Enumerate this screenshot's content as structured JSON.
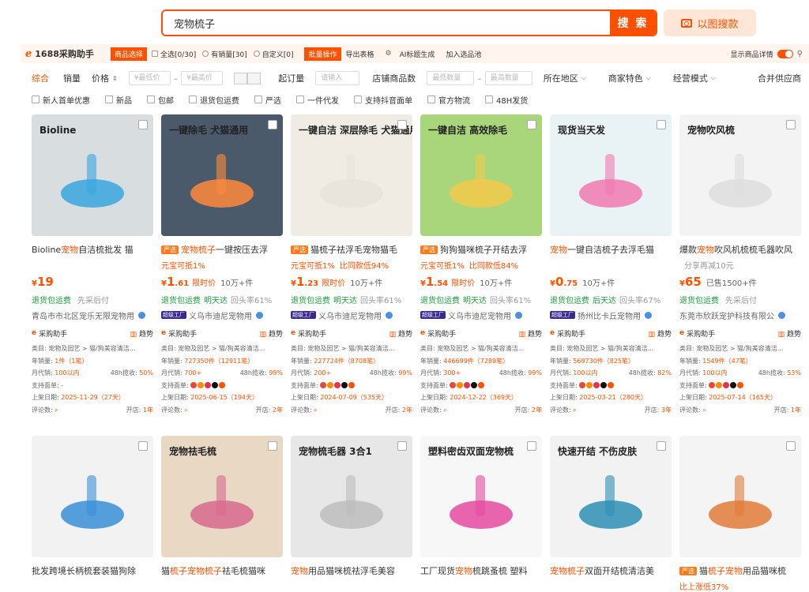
{
  "search": {
    "value": "宠物梳子",
    "button": "搜 索",
    "image_button": "以图搜款"
  },
  "helper": {
    "logo": "1688采购助手",
    "select_tag": "商品选择",
    "opts": [
      "全选[0/30]",
      "有销量[30]",
      "自定义[0]"
    ],
    "batch_tag": "批量操作",
    "links": [
      "导出表格",
      "AI标题生成",
      "加入选品池"
    ],
    "detail_toggle": "显示商品详情"
  },
  "filters": {
    "sort": [
      "综合",
      "销量",
      "价格"
    ],
    "price_min": "¥最低价",
    "price_max": "¥最高价",
    "moq_label": "起订量",
    "moq_ph": "请输入",
    "shops_label": "店铺商品数",
    "min_ph": "最低数量",
    "max_ph": "最高数量",
    "dropdowns": [
      "所在地区",
      "商家特色",
      "经营模式"
    ],
    "merge": "合并供应商",
    "checks": [
      "新人首单优惠",
      "新品",
      "包邮",
      "退货包运费",
      "严选",
      "一件代发",
      "支持抖音面单",
      "官方物流",
      "48H发货"
    ]
  },
  "products": [
    {
      "title_pre": "Bioline",
      "title_hl": "宠物",
      "title_post": "自洁梳批发 猫",
      "yx": "",
      "sub": "",
      "sub_gray": "",
      "price": "19",
      "price_dec": "",
      "price_note": "",
      "sold": "",
      "svc": [
        "退货包运费",
        ""
      ],
      "svc_gray": "先采后付",
      "shop": "青岛市市北区宠乐无限宠物用",
      "shop_badge": "",
      "helper": "采购助手",
      "trend": "趋势",
      "cat": "类目: 宠物及园艺 > 猫/狗美容清洁...",
      "year": "年销量:",
      "year_v": "1件（1笔）",
      "month": "月代销:",
      "month_v": "100以内",
      "h48": "48h揽收:",
      "h48_v": "50%",
      "support": "支持面单: -",
      "listed": "上架日期:",
      "listed_v": "2025-11-29（27天）",
      "review": "评论数:",
      "open": "开店:",
      "open_v": "1年"
    },
    {
      "title_pre": "",
      "title_hl": "宠物梳子",
      "title_post": "一键按压去浮",
      "yx": "严选",
      "sub": "元宝可抵1%",
      "sub_gray": "",
      "price": "1",
      "price_dec": ".61",
      "price_note": "限时价",
      "sold": "10万+件",
      "svc": [
        "退货包运费",
        "明天达"
      ],
      "svc_gray": "回头率61%",
      "shop": "义乌市迪尼宠物用",
      "shop_badge": "超级工厂",
      "helper": "采购助手",
      "trend": "趋势",
      "cat": "类目: 宠物及园艺 > 猫/狗美容清洁...",
      "year": "年销量:",
      "year_v": "727350件（12911笔）",
      "month": "月代销:",
      "month_v": "700+",
      "h48": "48h揽收:",
      "h48_v": "99%",
      "support": "支持面单:",
      "listed": "上架日期:",
      "listed_v": "2025-06-15（194天）",
      "review": "评论数:",
      "open": "开店:",
      "open_v": "2年"
    },
    {
      "title_pre": "",
      "title_hl": "",
      "title_post": "猫梳子祛浮毛宠物猫毛",
      "yx": "严选",
      "sub": "元宝可抵1%",
      "sub_gray": "比同款低94%",
      "price": "1",
      "price_dec": ".23",
      "price_note": "限时价",
      "sold": "10万+件",
      "svc": [
        "退货包运费",
        "明天达"
      ],
      "svc_gray": "回头率61%",
      "shop": "义乌市迪尼宠物用",
      "shop_badge": "超级工厂",
      "helper": "采购助手",
      "trend": "趋势",
      "cat": "类目: 宠物及园艺 > 猫/狗美容清洁...",
      "year": "年销量:",
      "year_v": "227724件（8708笔）",
      "month": "月代销:",
      "month_v": "200+",
      "h48": "48h揽收:",
      "h48_v": "99%",
      "support": "支持面单:",
      "listed": "上架日期:",
      "listed_v": "2024-07-09（535天）",
      "review": "评论数:",
      "open": "开店:",
      "open_v": "2年"
    },
    {
      "title_pre": "",
      "title_hl": "",
      "title_post": "狗狗猫咪梳子开结去浮",
      "yx": "严选",
      "sub": "元宝可抵1%",
      "sub_gray": "比同款低84%",
      "price": "1",
      "price_dec": ".54",
      "price_note": "限时价",
      "sold": "10万+件",
      "svc": [
        "退货包运费",
        "明天达"
      ],
      "svc_gray": "回头率61%",
      "shop": "义乌市迪尼宠物用",
      "shop_badge": "超级工厂",
      "helper": "采购助手",
      "trend": "趋势",
      "cat": "类目: 宠物及园艺 > 猫/狗美容清洁...",
      "year": "年销量:",
      "year_v": "446699件（7289笔）",
      "month": "月代销:",
      "month_v": "300+",
      "h48": "48h揽收:",
      "h48_v": "99%",
      "support": "支持面单:",
      "listed": "上架日期:",
      "listed_v": "2024-12-22（369天）",
      "review": "评论数:",
      "open": "开店:",
      "open_v": "2年"
    },
    {
      "title_pre": "",
      "title_hl": "宠物",
      "title_post": "一键自洁梳子去浮毛猫",
      "yx": "",
      "sub": "",
      "sub_gray": "",
      "price": "0",
      "price_dec": ".75",
      "price_note": "",
      "sold": "10万+件",
      "svc": [
        "退货包运费",
        "后天达"
      ],
      "svc_gray": "回头率67%",
      "shop": "扬州比卡丘宠物用",
      "shop_badge": "超级工厂",
      "helper": "采购助手",
      "trend": "趋势",
      "cat": "类目: 宠物及园艺 > 猫/狗美容清洁...",
      "year": "年销量:",
      "year_v": "569730件（825笔）",
      "month": "月代销:",
      "month_v": "100以内",
      "h48": "48h揽收:",
      "h48_v": "82%",
      "support": "支持面单:",
      "listed": "上架日期:",
      "listed_v": "2025-03-21（280天）",
      "review": "评论数:",
      "open": "开店:",
      "open_v": "3年"
    },
    {
      "title_pre": "爆款",
      "title_hl": "宠物",
      "title_post": "吹风机梳梳毛器吹风",
      "yx": "",
      "sub": "",
      "sub_gray": "分享再减10元",
      "price": "65",
      "price_dec": "",
      "price_note": "",
      "sold": "已售1500+件",
      "svc": [
        "退货包运费",
        ""
      ],
      "svc_gray": "先采后付",
      "shop": "东莞市欣跃宠护科技有限公",
      "shop_badge": "",
      "helper": "采购助手",
      "trend": "趋势",
      "cat": "类目: 宠物及园艺 > 猫/狗美容清洁...",
      "year": "年销量:",
      "year_v": "1549件（47笔）",
      "month": "月代销:",
      "month_v": "100以内",
      "h48": "48h揽收:",
      "h48_v": "53%",
      "support": "支持面单:",
      "listed": "上架日期:",
      "listed_v": "2025-07-14（165天）",
      "review": "评论数:",
      "open": "开店:",
      "open_v": "1年"
    }
  ],
  "row2": [
    {
      "title_pre": "批发跨境长柄梳套装猫狗除",
      "title_hl": "",
      "title_post": "",
      "yx": "",
      "sub": ""
    },
    {
      "title_pre": "猫",
      "title_hl": "梳子宠物梳子",
      "title_post": "祛毛梳猫咪",
      "yx": "",
      "sub": ""
    },
    {
      "title_pre": "",
      "title_hl": "宠物",
      "title_post": "用品猫咪梳祛浮毛美容",
      "yx": "",
      "sub": ""
    },
    {
      "title_pre": "工厂现货",
      "title_hl": "宠物",
      "title_post": "梳跳蚤梳 塑料",
      "yx": "",
      "sub": ""
    },
    {
      "title_pre": "",
      "title_hl": "宠物梳子",
      "title_post": "双面开结梳清洁美",
      "yx": "",
      "sub": ""
    },
    {
      "title_pre": "猫",
      "title_hl": "梳子宠物",
      "title_post": "用品猫咪梳",
      "yx": "严选",
      "sub": "比上涨低37%"
    }
  ],
  "thumbs": [
    {
      "bg": "#d8dde0",
      "text": "Bioline",
      "accent": "#39a7de"
    },
    {
      "bg": "#4a5a6a",
      "text": "一键除毛 犬猫通用",
      "accent": "#ff8a3d"
    },
    {
      "bg": "#f0ece4",
      "text": "一键自洁 深层除毛 犬猫通用",
      "accent": "#e8e4dc"
    },
    {
      "bg": "#a9d67a",
      "text": "一键自洁 高效除毛",
      "accent": "#f2c94c"
    },
    {
      "bg": "#e9f2f5",
      "text": "现货当天发",
      "accent": "#f07ab0"
    },
    {
      "bg": "#f3f3f3",
      "text": "宠物吹风梳",
      "accent": "#dddddd"
    },
    {
      "bg": "#f2f2f2",
      "text": "",
      "accent": "#3a8fd8"
    },
    {
      "bg": "#e9d8c4",
      "text": "宠物祛毛梳",
      "accent": "#d86a8e"
    },
    {
      "bg": "#e7e7e7",
      "text": "宠物梳毛器 3合1",
      "accent": "#bdbdbd"
    },
    {
      "bg": "#f7f7f7",
      "text": "塑料密齿双面宠物梳",
      "accent": "#e54aa0"
    },
    {
      "bg": "#f2f2f2",
      "text": "快速开结 不伤皮肤",
      "accent": "#2f8fb6"
    },
    {
      "bg": "#f4f4f4",
      "text": "",
      "accent": "#e07b3a"
    }
  ]
}
